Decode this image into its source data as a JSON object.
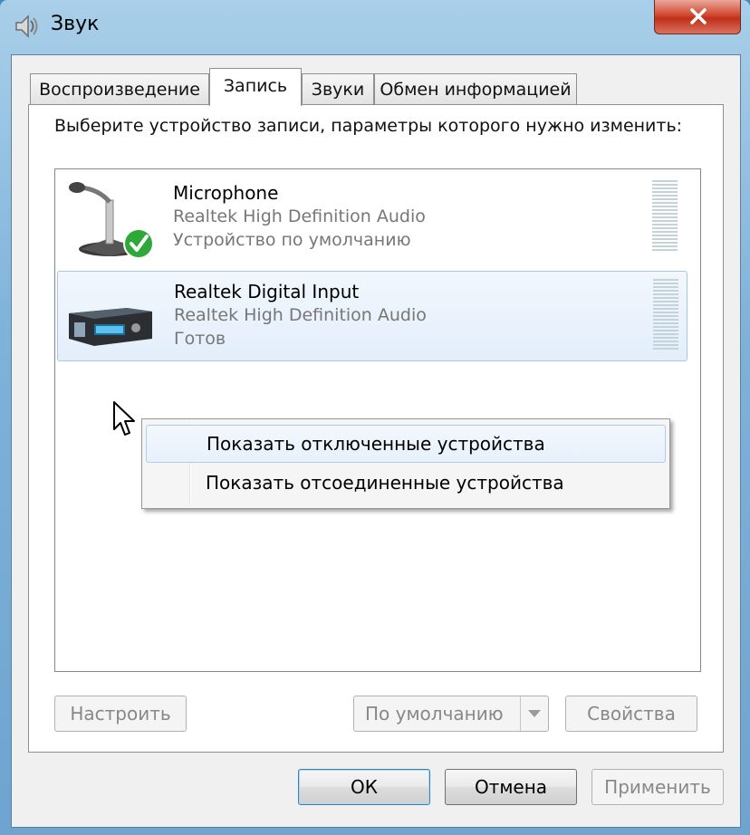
{
  "window": {
    "title": "Звук"
  },
  "tabs": [
    {
      "label": "Воспроизведение"
    },
    {
      "label": "Запись"
    },
    {
      "label": "Звуки"
    },
    {
      "label": "Обмен информацией"
    }
  ],
  "active_tab": "Запись",
  "prompt": "Выберите устройство записи, параметры которого нужно изменить:",
  "devices": [
    {
      "name": "Microphone",
      "driver": "Realtek High Definition Audio",
      "status": "Устройство по умолчанию",
      "icon": "microphone-icon",
      "is_default": true,
      "selected": false
    },
    {
      "name": "Realtek Digital Input",
      "driver": "Realtek High Definition Audio",
      "status": "Готов",
      "icon": "digital-input-device-icon",
      "is_default": false,
      "selected": true
    }
  ],
  "context_menu": {
    "items": [
      {
        "label": "Показать отключенные устройства",
        "highlighted": true
      },
      {
        "label": "Показать отсоединенные устройства",
        "highlighted": false
      }
    ]
  },
  "panel_buttons": {
    "configure": "Настроить",
    "set_default": "По умолчанию",
    "properties": "Свойства"
  },
  "dialog_buttons": {
    "ok": "ОК",
    "cancel": "Отмена",
    "apply": "Применить"
  },
  "colors": {
    "title_bar": "#7fb2d9",
    "close_button": "#d2472f",
    "selection": "#e3eefb",
    "default_check": "#2fa83a"
  }
}
